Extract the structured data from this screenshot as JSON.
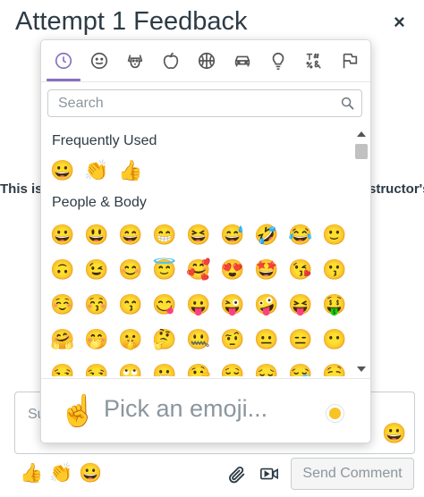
{
  "dialog": {
    "title": "Attempt 1 Feedback",
    "close_symbol": "×"
  },
  "background": {
    "left_text": "This is",
    "right_text": "structor's"
  },
  "picker": {
    "categories": [
      {
        "name": "clock-icon"
      },
      {
        "name": "smiley-icon"
      },
      {
        "name": "dog-icon"
      },
      {
        "name": "apple-icon"
      },
      {
        "name": "basketball-icon"
      },
      {
        "name": "car-icon"
      },
      {
        "name": "lightbulb-icon"
      },
      {
        "name": "symbols-icon"
      },
      {
        "name": "flags-icon"
      }
    ],
    "search_placeholder": "Search",
    "sections": {
      "frequent_label": "Frequently Used",
      "people_label": "People & Body"
    },
    "frequent": [
      "😀",
      "👏",
      "👍"
    ],
    "people_rows": [
      [
        "😀",
        "😃",
        "😄",
        "😁",
        "😆",
        "😅",
        "🤣",
        "😂",
        "🙂"
      ],
      [
        "🙃",
        "😉",
        "😊",
        "😇",
        "🥰",
        "😍",
        "🤩",
        "😘",
        "😗"
      ],
      [
        "☺️",
        "😚",
        "😙",
        "😋",
        "😛",
        "😜",
        "🤪",
        "😝",
        "🤑"
      ],
      [
        "🤗",
        "🤭",
        "🤫",
        "🤔",
        "🤐",
        "🤨",
        "😐",
        "😑",
        "😶"
      ],
      [
        "😏",
        "😒",
        "🙄",
        "😬",
        "🤥",
        "😌",
        "😔",
        "😪",
        "🤤"
      ]
    ],
    "preview_emoji": "☝️",
    "preview_text": "Pick an emoji...",
    "skin_tone_color": "#f7c325",
    "accent_color": "#8a6fc1"
  },
  "comment": {
    "placeholder_visible": "Su",
    "box_emoji": "😀"
  },
  "bottom_bar": {
    "quick_emojis": [
      "👍",
      "👏",
      "😀"
    ],
    "attach_icon": "paperclip-icon",
    "media_icon": "media-icon",
    "send_label": "Send Comment"
  }
}
